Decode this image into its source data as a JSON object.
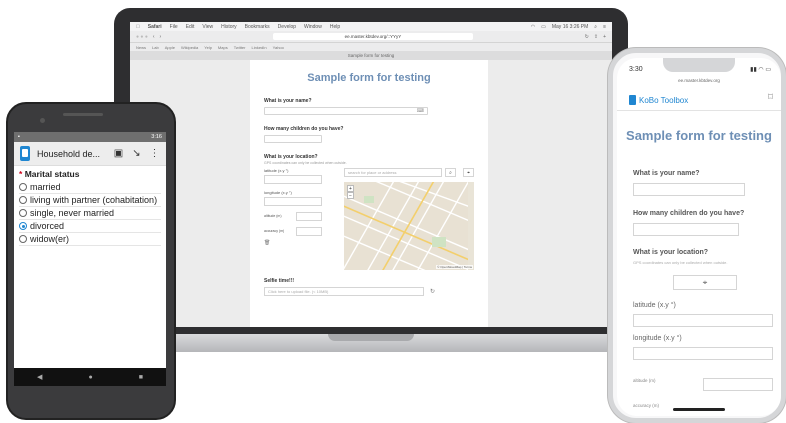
{
  "laptop": {
    "menubar": {
      "items": [
        "Safari",
        "File",
        "Edit",
        "View",
        "History",
        "Bookmarks",
        "Develop",
        "Window",
        "Help"
      ],
      "clock": "May 16 3:26 PM"
    },
    "browser": {
      "url": "ee.master.kbtdev.org/::YYyY",
      "bookmarks": [
        "News",
        "Lab",
        "Apple",
        "Wikipedia",
        "Yelp",
        "Maps",
        "Twitter",
        "LinkedIn",
        "Yahoo"
      ],
      "tab_title": "Sample form for testing"
    },
    "form": {
      "title": "Sample form for testing",
      "q_name": "What is your name?",
      "q_children": "How many children do you have?",
      "q_location": "What is your location?",
      "location_hint": "GPS coordinates can only be collected when outside.",
      "latitude_label": "latitude (x.y °)",
      "longitude_label": "longitude (x.y °)",
      "altitude_label": "altitude (m)",
      "accuracy_label": "accuracy (m)",
      "map_search_placeholder": "search for place or address",
      "map_attribution": "© OpenStreetMap | Terms",
      "q_selfie": "Selfie time!!!",
      "upload_placeholder": "Click here to upload file. (< 10MB)"
    }
  },
  "android": {
    "status_time": "3:16",
    "toolbar_title": "Household de...",
    "question": "Marital status",
    "required_mark": "*",
    "options": [
      {
        "label": "married",
        "selected": false
      },
      {
        "label": "living with partner (cohabitation)",
        "selected": false
      },
      {
        "label": "single, never married",
        "selected": false
      },
      {
        "label": "divorced",
        "selected": true
      },
      {
        "label": "widow(er)",
        "selected": false
      }
    ],
    "nav": {
      "back": "◀",
      "home": "●",
      "recents": "■"
    }
  },
  "iphone": {
    "status_time": "3:30",
    "url": "ee.master.kbtdev.org",
    "brand": "KoBo Toolbox",
    "title": "Sample form for testing",
    "q_name": "What is your name?",
    "q_children": "How many children do you have?",
    "q_location": "What is your location?",
    "location_hint": "GPS coordinates can only be collected when outside.",
    "latitude_label": "latitude (x.y °)",
    "longitude_label": "longitude (x.y °)",
    "altitude_label": "altitude (m)",
    "accuracy_label": "accuracy (m)"
  }
}
